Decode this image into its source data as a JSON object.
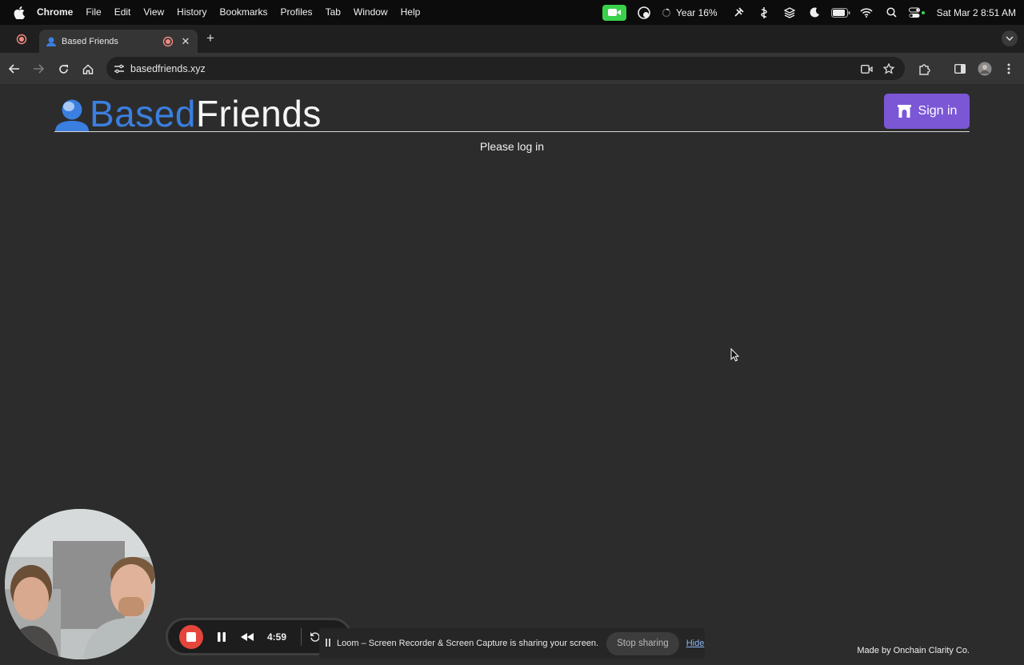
{
  "menubar": {
    "app": "Chrome",
    "items": [
      "File",
      "Edit",
      "View",
      "History",
      "Bookmarks",
      "Profiles",
      "Tab",
      "Window",
      "Help"
    ],
    "year_progress": "Year 16%",
    "clock": "Sat Mar 2  8:51 AM"
  },
  "browser": {
    "tab_title": "Based Friends",
    "url": "basedfriends.xyz"
  },
  "page": {
    "brand_part1": "Based",
    "brand_part2": "Friends",
    "signin_label": "Sign in",
    "login_message": "Please log in",
    "footer": "Made by Onchain Clarity Co.",
    "brand_color": "#3b7fe0",
    "button_color": "#7b57d6"
  },
  "loom": {
    "timer": "4:59",
    "share_message": "Loom – Screen Recorder & Screen Capture is sharing your screen.",
    "stop_sharing": "Stop sharing",
    "hide": "Hide"
  }
}
